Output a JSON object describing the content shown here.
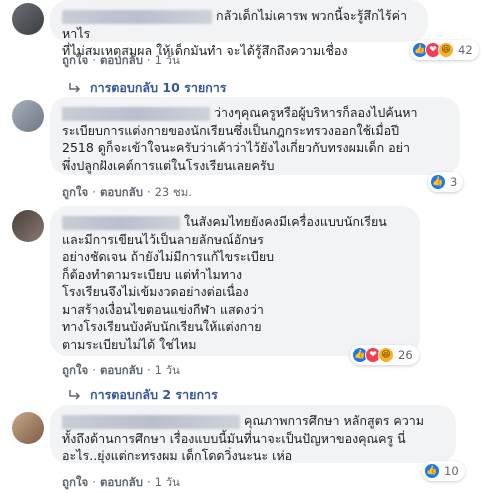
{
  "actions": {
    "like": "ถูกใจ",
    "reply": "ตอบกลับ",
    "dot": "·"
  },
  "comments": [
    {
      "text": "กลัวเด็กไม่เคารพ พวกนี้จะรู้สึกไร้ค่า หาไร\nที่ไม่สมเหตุสมผล ให้เด็กมันทำ จะได้รู้สึกถึงความเชื่อง",
      "time": "1 วัน",
      "reactions": [
        "like",
        "love",
        "haha"
      ],
      "reaction_count": "42",
      "replies_label": "การตอบกลับ 10 รายการ"
    },
    {
      "text": "ว่างๆคุณครูหรือผู้บริหารก็ลองไปค้นหา\nระเบียบการแต่งกายของนักเรียนซึ่งเป็นกฎกระทรวงออกใช้เมื่อปี\n2518 ดูก็จะเข้าใจนะครับว่าเค้าว่าไว้ยังไงเกี่ยวกับทรงผมเด็ก อย่า\nพึ่งปลูกฝังเคต์การแต่ในโรงเรียนเลยครับ",
      "time": "23 ชม.",
      "reactions": [
        "like"
      ],
      "reaction_count": "3"
    },
    {
      "text": "ในสังคมไทยยังคงมีเครื่องแบบนักเรียน\nและมีการเขียนไว้เป็นลายลักษณ์อักษร\nอย่างชัดเจน ถ้ายังไม่มีการแก้ไขระเบียบ\nก็ต้องทำตามระเบียบ แต่ทำไมทาง\nโรงเรียนจึงไม่เข้มงวดอย่างต่อเนื่อง\nมาสร้างเงื่อนไขตอนแข่งกีฬา แสดงว่า\nทางโรงเรียนบังคับนักเรียนให้แต่งกาย\nตามระเบียบไม่ได้ ใช่ไหม",
      "time": "1 วัน",
      "reactions": [
        "like",
        "love",
        "haha"
      ],
      "reaction_count": "26",
      "replies_label": "การตอบกลับ 2 รายการ"
    },
    {
      "text": "คุณภาพการศึกษา หลักสูตร ความ\nทั้งถึงด้านการศึกษา เรื่องแบบนี้มันที่นาจะเป็นปัญหาของคุณครู นี่\nอะไร..ยุ่งแต่กะทรงผม เด็กโดดวิ่งนะนะ เห่อ",
      "time": "1 วัน",
      "reactions": [
        "like"
      ],
      "reaction_count": "10"
    }
  ]
}
